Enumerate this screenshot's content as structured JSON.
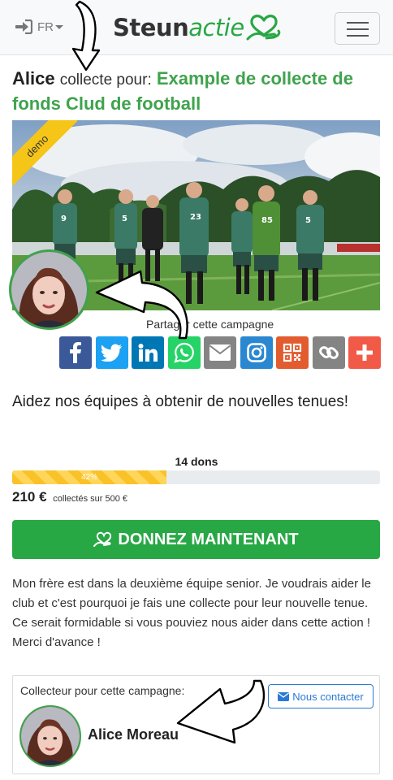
{
  "navbar": {
    "language": "FR",
    "logo_part1": "Steun",
    "logo_part2": "actie",
    "icons": [
      "sign-in-icon",
      "heart-hand-logo",
      "hamburger-menu-icon"
    ]
  },
  "campaign": {
    "collector_name": "Alice",
    "collects_for": "collecte pour:",
    "campaign_name": "Example de collecte de fonds Clud de football",
    "ribbon": "demo",
    "share_title": "Partager cette campagne",
    "heading": "Aidez nos équipes à obtenir de nouvelles tenues!",
    "donations_count": "14 dons",
    "progress_label": "42%",
    "progress_fraction": 0.42,
    "amount_raised": "210 €",
    "amount_goal_text": "collectés sur 500 €",
    "donate_button": "DONNEZ MAINTENANT",
    "description": "Mon frère est dans la deuxième équipe senior. Je voudrais aider le club et c'est pourquoi je fais une collecte pour leur nouvelle tenue. Ce serait formidable si vous pouviez nous aider dans cette action ! Merci d'avance !"
  },
  "share_buttons": [
    {
      "name": "facebook",
      "color": "#3b5998"
    },
    {
      "name": "twitter",
      "color": "#1da1f2"
    },
    {
      "name": "linkedin",
      "color": "#0077b5"
    },
    {
      "name": "whatsapp",
      "color": "#25d366"
    },
    {
      "name": "email",
      "color": "#848484"
    },
    {
      "name": "instagram",
      "color": "#2a87d0"
    },
    {
      "name": "qr-code",
      "color": "#e25c30"
    },
    {
      "name": "copy-link",
      "color": "#848484"
    },
    {
      "name": "more",
      "color": "#f25a48"
    }
  ],
  "collector_card": {
    "label": "Collecteur pour cette campagne:",
    "contact_button": "Nous contacter",
    "name": "Alice Moreau"
  },
  "colors": {
    "green": "#28a745",
    "title_green": "#3fa34d",
    "ribbon_yellow": "#f5c518",
    "progress_yellow": "#f9c228",
    "contact_blue": "#2a7ad5"
  }
}
